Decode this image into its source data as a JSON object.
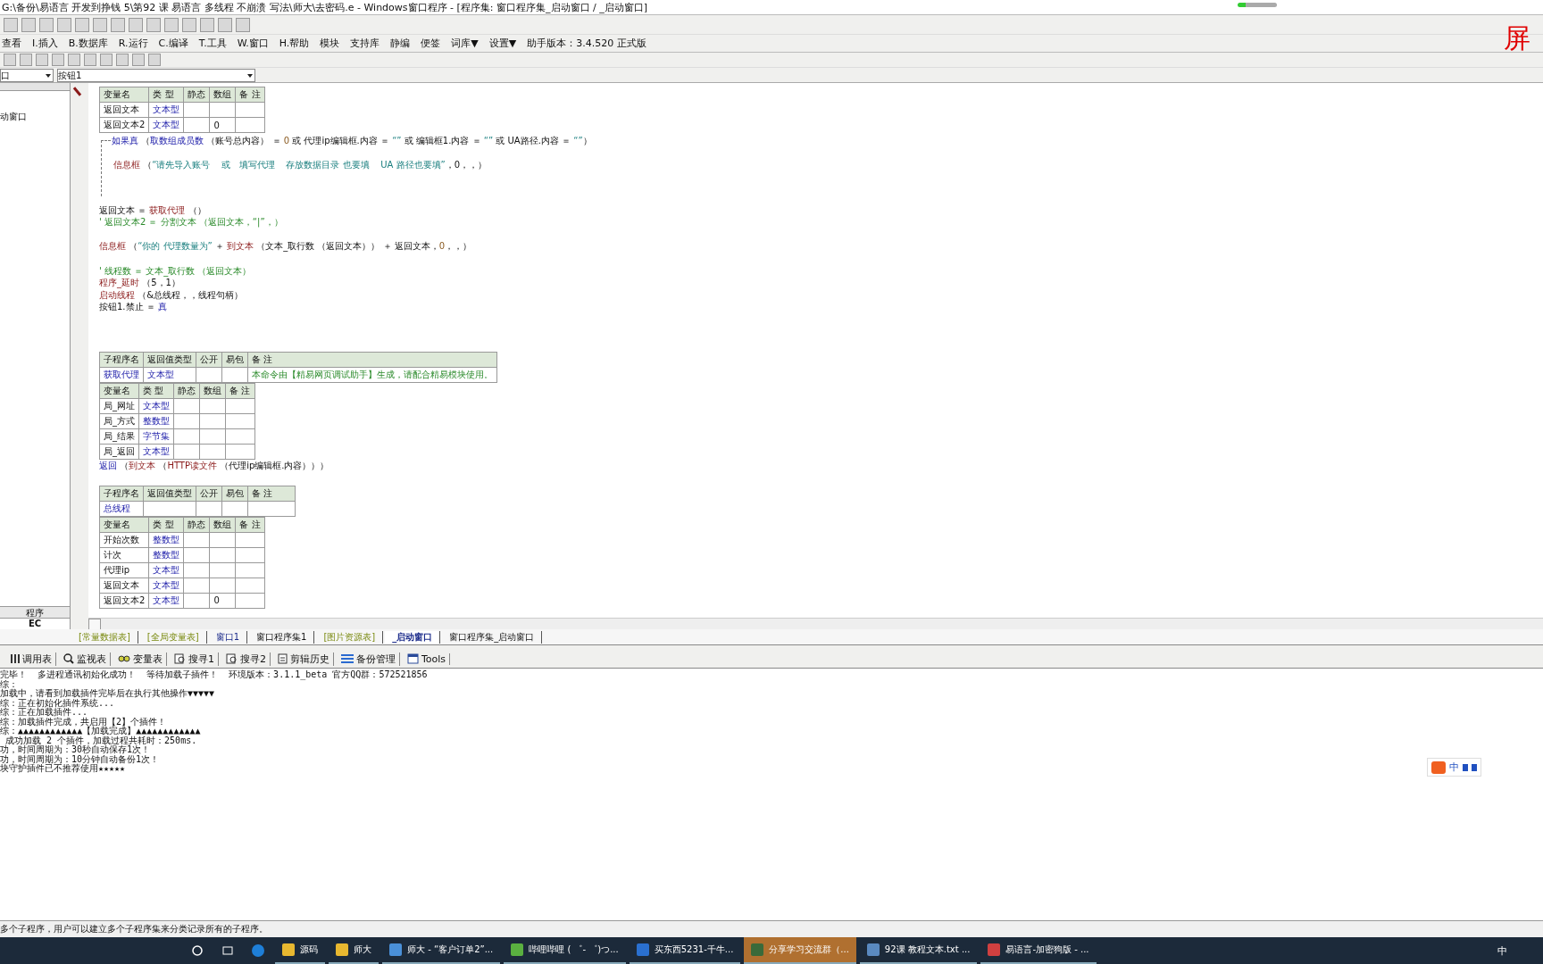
{
  "window": {
    "title": "G:\\备份\\易语言  开发到挣钱 5\\第92 课  易语言 多线程  不崩溃   写法\\师大\\去密码.e - Windows窗口程序 - [程序集: 窗口程序集_启动窗口 / _启动窗口]"
  },
  "overlay_text": "屏",
  "menu": [
    "查看",
    "I.插入",
    "B.数据库",
    "R.运行",
    "C.编译",
    "T.工具",
    "W.窗口",
    "H.帮助",
    "模块",
    "支持库",
    "静编",
    "便签",
    "词库▼",
    "设置▼",
    "助手版本：3.4.520 正式版"
  ],
  "combos": [
    {
      "value": "口"
    },
    {
      "value": "按钮1"
    }
  ],
  "left_panel": {
    "items": [
      "动窗口"
    ],
    "tabs": [
      {
        "label": "程序",
        "selected": false
      },
      {
        "label": "EC",
        "selected": true
      }
    ]
  },
  "code": [
    {
      "kind": "vartable",
      "headers": [
        "变量名",
        "类 型",
        "静态",
        "数组",
        "备 注"
      ],
      "rows": [
        {
          "name": "返回文本",
          "type": "文本型"
        },
        {
          "name": "返回文本2",
          "type": "文本型",
          "array": "0"
        }
      ]
    },
    {
      "kind": "if",
      "condition": [
        {
          "text": "如果真",
          "kind": "flow"
        },
        {
          "text": " （",
          "kind": "plain"
        },
        {
          "text": "取数组成员数",
          "kind": "flow"
        },
        {
          "text": " （账号总内容） ＝ ",
          "kind": "plain"
        },
        {
          "text": "0",
          "kind": "num"
        },
        {
          "text": " 或 代理ip编辑框.内容 ＝ ",
          "kind": "plain"
        },
        {
          "text": "“”",
          "kind": "str"
        },
        {
          "text": " 或 编辑框1.内容 ＝ ",
          "kind": "plain"
        },
        {
          "text": "“”",
          "kind": "str"
        },
        {
          "text": " 或 UA路径.内容 ＝ ",
          "kind": "plain"
        },
        {
          "text": "“”",
          "kind": "str"
        },
        {
          "text": "）",
          "kind": "plain"
        }
      ],
      "body": [
        [
          {
            "text": "信息框",
            "kind": "cmd"
          },
          {
            "text": " （",
            "kind": "plain"
          },
          {
            "text": "“请先导入账号    或   填写代理    存放数据目录 也要填    UA 路径也要填”",
            "kind": "str"
          },
          {
            "text": "，0，，）",
            "kind": "plain"
          }
        ]
      ]
    },
    {
      "kind": "blank"
    },
    {
      "kind": "line",
      "segments": [
        {
          "text": "返回文本 ＝ ",
          "kind": "plain"
        },
        {
          "text": "获取代理",
          "kind": "cmd"
        },
        {
          "text": " （）",
          "kind": "plain"
        }
      ]
    },
    {
      "kind": "line",
      "segments": [
        {
          "text": "' 返回文本2 ＝ 分割文本 （返回文本，“|”，）",
          "kind": "comment"
        }
      ]
    },
    {
      "kind": "blank"
    },
    {
      "kind": "line",
      "segments": [
        {
          "text": "信息框",
          "kind": "cmd"
        },
        {
          "text": " （",
          "kind": "plain"
        },
        {
          "text": "“你的 代理数量为”",
          "kind": "str"
        },
        {
          "text": " ＋ ",
          "kind": "plain"
        },
        {
          "text": "到文本",
          "kind": "cmd"
        },
        {
          "text": " （文本_取行数 （返回文本）） ＋ 返回文本，",
          "kind": "plain"
        },
        {
          "text": "0",
          "kind": "num"
        },
        {
          "text": "，，）",
          "kind": "plain"
        }
      ]
    },
    {
      "kind": "blank"
    },
    {
      "kind": "line",
      "segments": [
        {
          "text": "' 线程数 ＝ 文本_取行数 （返回文本）",
          "kind": "comment"
        }
      ]
    },
    {
      "kind": "line",
      "segments": [
        {
          "text": "程序_延时",
          "kind": "cmd"
        },
        {
          "text": " （5，1）",
          "kind": "plain"
        }
      ]
    },
    {
      "kind": "line",
      "segments": [
        {
          "text": "启动线程",
          "kind": "cmd"
        },
        {
          "text": " （&总线程，，线程句柄）",
          "kind": "plain"
        }
      ]
    },
    {
      "kind": "line",
      "segments": [
        {
          "text": "按钮1.禁止 ＝ ",
          "kind": "plain"
        },
        {
          "text": "真",
          "kind": "flow"
        }
      ]
    },
    {
      "kind": "blank"
    },
    {
      "kind": "blank"
    },
    {
      "kind": "blank"
    },
    {
      "kind": "subtable",
      "headers": [
        "子程序名",
        "返回值类型",
        "公开",
        "易包",
        "备 注"
      ],
      "rows": [
        {
          "name": "获取代理",
          "type": "文本型",
          "note": "本命令由【精易网页调试助手】生成，请配合精易模块使用。"
        }
      ]
    },
    {
      "kind": "vartable",
      "headers": [
        "变量名",
        "类 型",
        "静态",
        "数组",
        "备 注"
      ],
      "rows": [
        {
          "name": "局_网址",
          "type": "文本型"
        },
        {
          "name": "局_方式",
          "type": "整数型"
        },
        {
          "name": "局_结果",
          "type": "字节集"
        },
        {
          "name": "局_返回",
          "type": "文本型"
        }
      ]
    },
    {
      "kind": "line",
      "segments": [
        {
          "text": "返回",
          "kind": "flow"
        },
        {
          "text": " （",
          "kind": "plain"
        },
        {
          "text": "到文本",
          "kind": "cmd"
        },
        {
          "text": " （",
          "kind": "plain"
        },
        {
          "text": "HTTP读文件",
          "kind": "cmd"
        },
        {
          "text": " （代理ip编辑框.内容）））",
          "kind": "plain"
        }
      ]
    },
    {
      "kind": "blank"
    },
    {
      "kind": "subtable",
      "headers": [
        "子程序名",
        "返回值类型",
        "公开",
        "易包",
        "备 注"
      ],
      "rows": [
        {
          "name": "总线程"
        }
      ]
    },
    {
      "kind": "vartable",
      "headers": [
        "变量名",
        "类 型",
        "静态",
        "数组",
        "备 注"
      ],
      "rows": [
        {
          "name": "开始次数",
          "type": "整数型"
        },
        {
          "name": "计次",
          "type": "整数型"
        },
        {
          "name": "代理ip",
          "type": "文本型"
        },
        {
          "name": "返回文本",
          "type": "文本型"
        },
        {
          "name": "返回文本2",
          "type": "文本型",
          "array": "0"
        }
      ]
    }
  ],
  "editor_tabs": [
    {
      "label": "[常量数据表]",
      "kind": "resource",
      "selected": false
    },
    {
      "label": "[全局变量表]",
      "kind": "resource",
      "selected": false
    },
    {
      "label": "窗口1",
      "kind": "window",
      "selected": false
    },
    {
      "label": "窗口程序集1",
      "kind": "code",
      "selected": false
    },
    {
      "label": "[图片资源表]",
      "kind": "resource",
      "selected": false
    },
    {
      "label": "_启动窗口",
      "kind": "window",
      "selected": true
    },
    {
      "label": "窗口程序集_启动窗口",
      "kind": "code",
      "selected": false
    }
  ],
  "panel_tools": [
    {
      "label": "调用表",
      "kind": "grid"
    },
    {
      "label": "监视表",
      "kind": "search"
    },
    {
      "label": "变量表",
      "kind": "glasses"
    },
    {
      "label": "搜寻1",
      "kind": "find"
    },
    {
      "label": "搜寻2",
      "kind": "find"
    },
    {
      "label": "剪辑历史",
      "kind": "doc"
    },
    {
      "label": "备份管理",
      "kind": "list"
    },
    {
      "label": "Tools",
      "kind": "window"
    }
  ],
  "output": [
    "完毕！  多进程通讯初始化成功！  等待加载子插件！  环境版本：3.1.1_beta 官方QQ群：572521856",
    "综：",
    "加载中，请看到加载插件完毕后在执行其他操作▼▼▼▼▼",
    "综：正在初始化插件系统...",
    "综：正在加载插件...",
    "综：加载插件完成，共启用【2】个插件！",
    "综：▲▲▲▲▲▲▲▲▲▲▲▲【加载完成】▲▲▲▲▲▲▲▲▲▲▲▲",
    " 成功加载 2 个插件，加载过程共耗时：250ms.",
    "功，时间周期为：30秒自动保存1次！",
    "功，时间周期为：10分钟自动备份1次！",
    "块守护插件已不推荐使用★★★★★"
  ],
  "ime": {
    "label": "中"
  },
  "status_bar": "多个子程序，用户可以建立多个子程序集来分类记录所有的子程序。",
  "taskbar": {
    "items": [
      {
        "label": "源码",
        "kind": "folder",
        "selected": false
      },
      {
        "label": "师大",
        "kind": "folder",
        "selected": false
      },
      {
        "label": "师大 - “客户订单2”...",
        "kind": "box",
        "selected": false
      },
      {
        "label": "哔哩哔哩 ( ゜- ゜)つ...",
        "kind": "green",
        "selected": false
      },
      {
        "label": "买东西5231-千牛...",
        "kind": "blue",
        "selected": false
      },
      {
        "label": "分享学习交流群（...",
        "kind": "chat",
        "selected": true
      },
      {
        "label": "92课 教程文本.txt ...",
        "kind": "note",
        "selected": false
      },
      {
        "label": "易语言-加密狗版 - ...",
        "kind": "app",
        "selected": false
      }
    ],
    "tray_label": "中"
  }
}
